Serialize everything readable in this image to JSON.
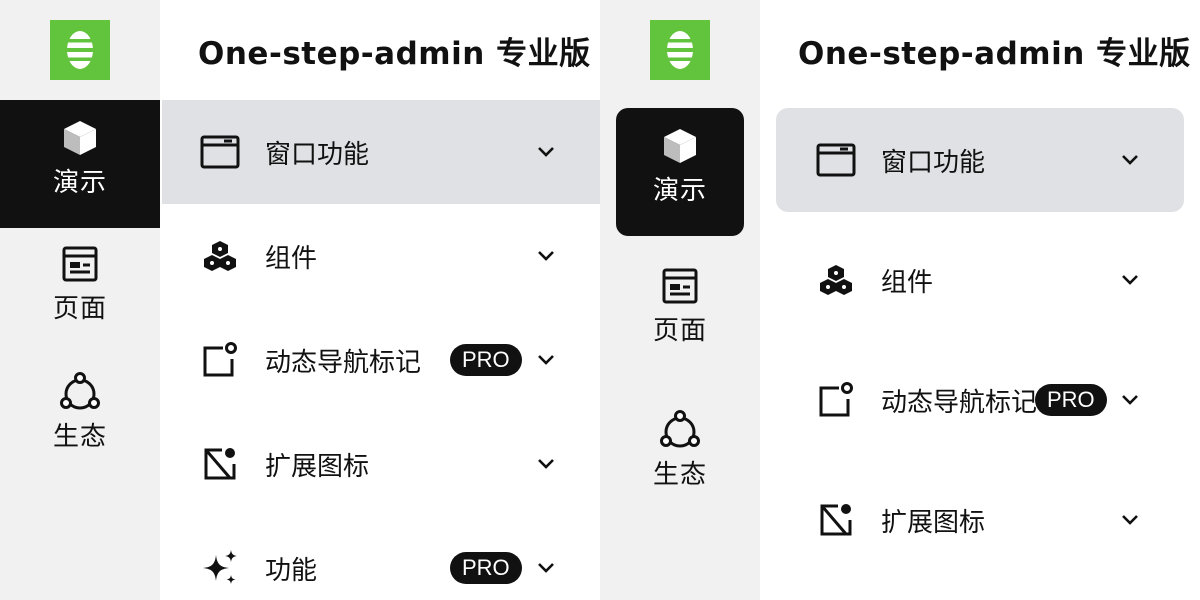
{
  "title": "One-step-admin 专业版",
  "rail": {
    "items": [
      {
        "label": "演示",
        "icon": "cube-icon"
      },
      {
        "label": "页面",
        "icon": "page-icon"
      },
      {
        "label": "生态",
        "icon": "ecosystem-icon"
      }
    ]
  },
  "menu": {
    "items": [
      {
        "label": "窗口功能",
        "icon": "window-icon"
      },
      {
        "label": "组件",
        "icon": "components-icon"
      },
      {
        "label": "动态导航标记",
        "icon": "nav-badge-icon",
        "badge": "PRO"
      },
      {
        "label": "扩展图标",
        "icon": "extend-icon"
      },
      {
        "label": "功能",
        "icon": "sparkles-icon",
        "badge": "PRO"
      }
    ]
  },
  "colors": {
    "brand": "#62c43c",
    "active_bg": "#111111",
    "menu_active_bg": "#dfe1e4",
    "rail_bg": "#f1f1f1"
  }
}
